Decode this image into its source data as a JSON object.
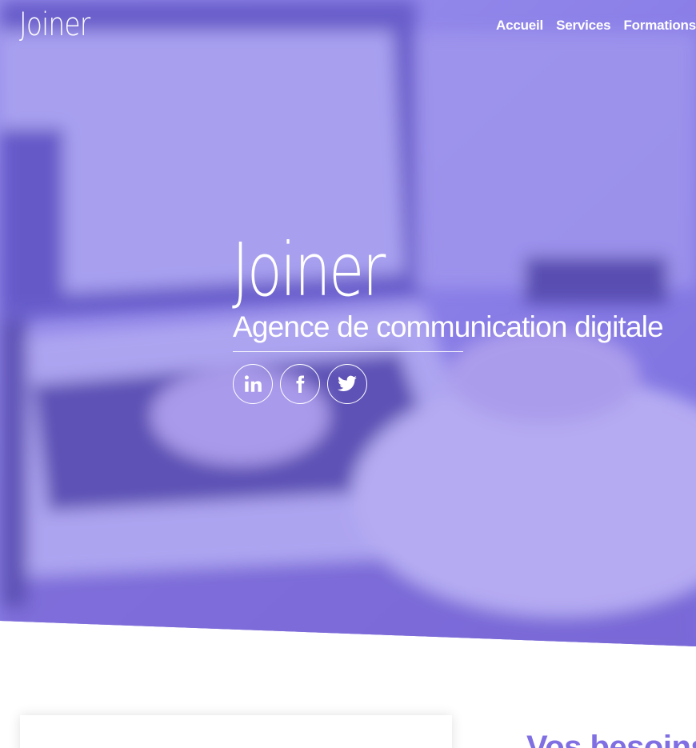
{
  "nav": {
    "brand": "Joiner",
    "links": [
      "Accueil",
      "Services",
      "Formations"
    ]
  },
  "hero": {
    "title": "Joiner",
    "subtitle": "Agence de communication digitale",
    "socials": [
      {
        "icon": "linkedin-icon",
        "label": "in"
      },
      {
        "icon": "facebook-icon",
        "label": "f"
      },
      {
        "icon": "twitter-icon",
        "label": "twitter"
      }
    ]
  },
  "section": {
    "heading": "Vos besoins"
  },
  "colors": {
    "overlay": "#7868e6",
    "accent": "#7f6fe2",
    "text_light": "#ffffff"
  }
}
